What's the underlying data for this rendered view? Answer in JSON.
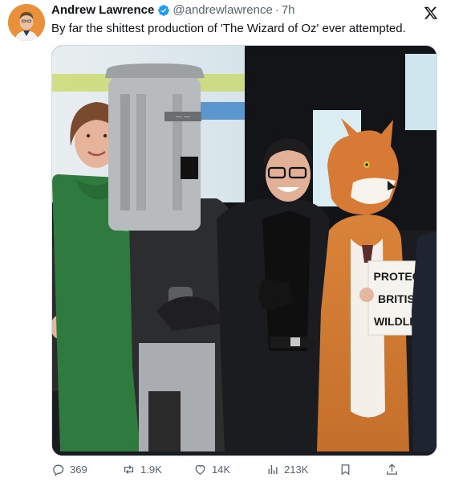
{
  "author": {
    "name": "Andrew Lawrence",
    "handle": "@andrewlawrence",
    "separator": "·",
    "time": "7h",
    "verified": true
  },
  "tweet": {
    "text": "By far the shittest production of 'The Wizard of Oz' ever attempted."
  },
  "media": {
    "sign_lines": [
      "PROTECT",
      "BRITISH",
      "WILDLIFE"
    ],
    "helmet_text": "~~ ~~"
  },
  "actions": {
    "replies": "369",
    "reposts": "1.9K",
    "likes": "14K",
    "views": "213K"
  },
  "icons": {
    "platform": "x-logo-icon",
    "verified": "verified-badge-icon",
    "reply": "reply-icon",
    "repost": "repost-icon",
    "like": "heart-icon",
    "views": "views-icon",
    "bookmark": "bookmark-icon",
    "share": "share-icon"
  },
  "colors": {
    "verified_blue": "#1d9bf0",
    "secondary_text": "#536471",
    "avatar_bg": "#e8913a"
  }
}
